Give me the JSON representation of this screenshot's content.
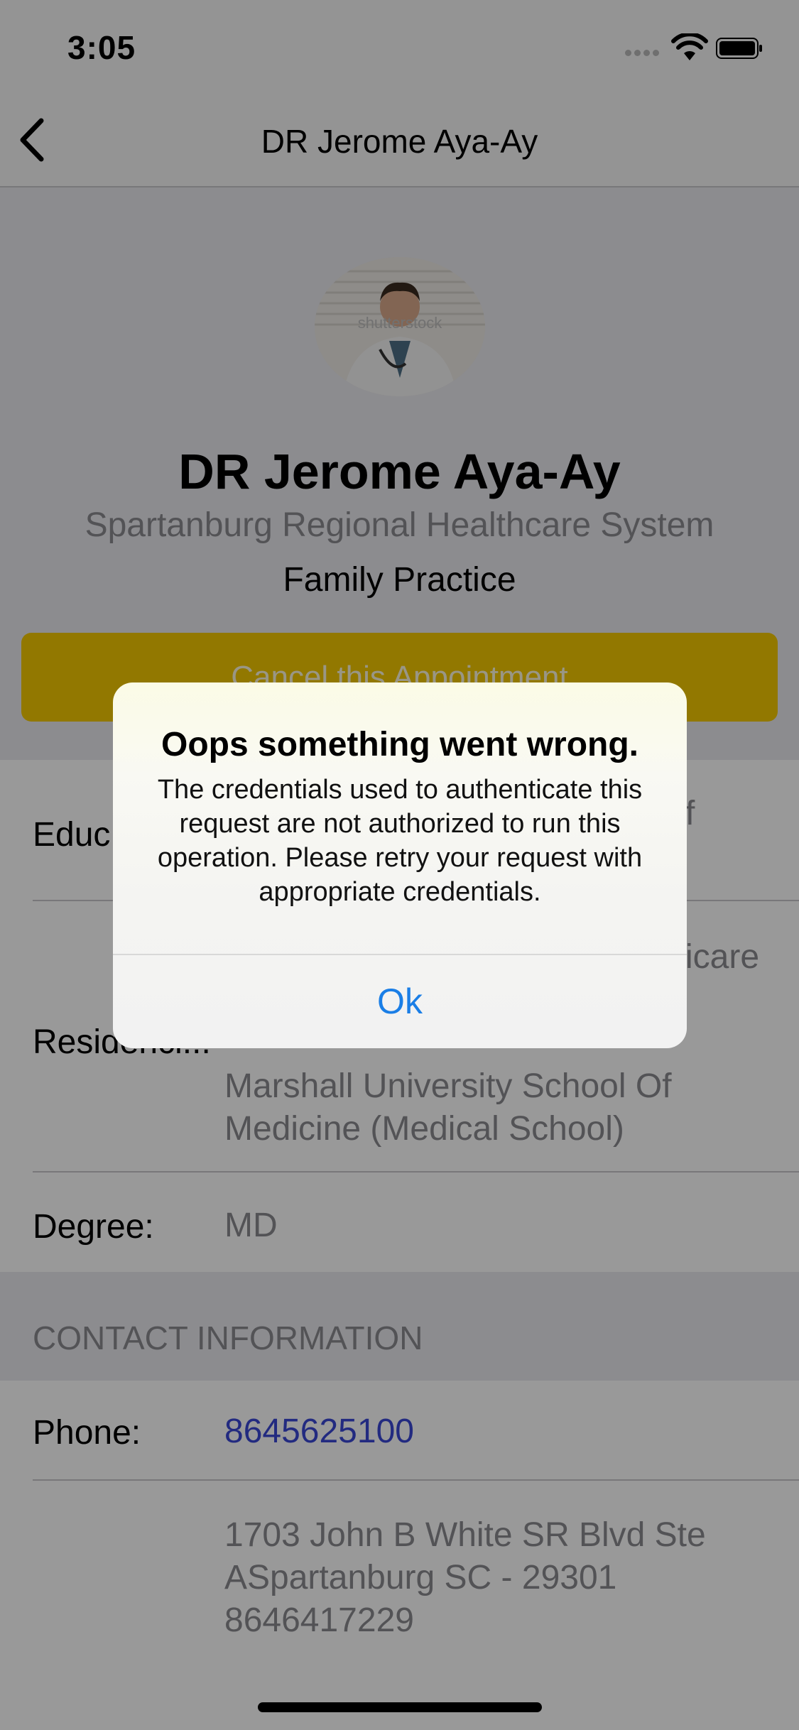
{
  "status_bar": {
    "time": "3:05"
  },
  "nav": {
    "title": "DR Jerome Aya-Ay"
  },
  "profile": {
    "name": "DR Jerome Aya-Ay",
    "organization": "Spartanburg Regional Healthcare System",
    "specialty": "Family Practice",
    "cancel_button": "Cancel this Appointment",
    "avatar_watermark": "shutterstock"
  },
  "details": {
    "education_label": "Educ",
    "education_value_tail": "f",
    "residency_label": "Residenci...",
    "residency_value_tail": "icare",
    "medical_school": "Marshall University School Of Medicine (Medical School)",
    "degree_label": "Degree:",
    "degree_value": "MD"
  },
  "contact": {
    "section_title": "CONTACT INFORMATION",
    "phone_label": "Phone:",
    "phone_value": "8645625100",
    "address": "1703 John B White SR Blvd Ste ASpartanburg SC - 29301 8646417229"
  },
  "alert": {
    "title": "Oops something went wrong.",
    "message": "The credentials used to authenticate this request are not authorized to run this operation. Please retry your request with appropriate credentials.",
    "ok_label": "Ok"
  },
  "colors": {
    "accent": "#f4c900",
    "link": "#3a47d6",
    "alert_button": "#1a7ee6",
    "secondary_text": "#8a8a8f"
  }
}
